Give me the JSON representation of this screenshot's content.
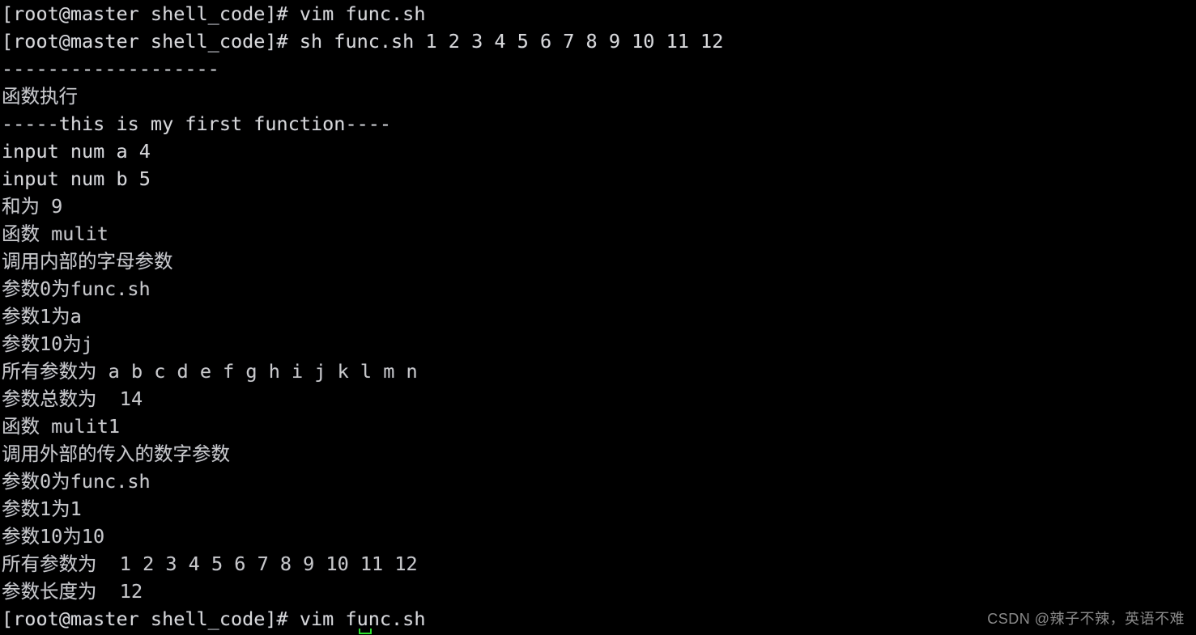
{
  "terminal": {
    "background_color": "#000000",
    "foreground_color": "#d8d8d8",
    "cursor_color": "#2ee02e",
    "prompt": "[root@master shell_code]#",
    "lines": [
      "[root@master shell_code]# vim func.sh",
      "[root@master shell_code]# sh func.sh 1 2 3 4 5 6 7 8 9 10 11 12",
      "-------------------",
      "函数执行",
      "-----this is my first function----",
      "input num a 4",
      "input num b 5",
      "和为 9",
      "函数 mulit",
      "调用内部的字母参数",
      "参数0为func.sh",
      "参数1为a",
      "参数10为j",
      "所有参数为 a b c d e f g h i j k l m n",
      "参数总数为  14",
      "函数 mulit1",
      "调用外部的传入的数字参数",
      "参数0为func.sh",
      "参数1为1",
      "参数10为10",
      "所有参数为  1 2 3 4 5 6 7 8 9 10 11 12",
      "参数长度为  12",
      "[root@master shell_code]# vim func.sh"
    ]
  },
  "watermark": {
    "text": "CSDN @辣子不辣，英语不难",
    "color": "#8a8a8a"
  }
}
